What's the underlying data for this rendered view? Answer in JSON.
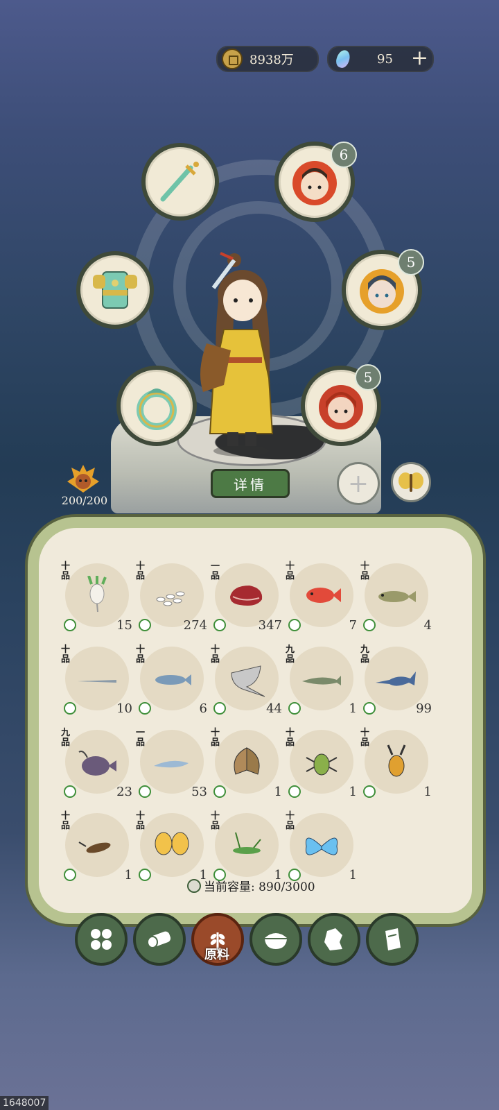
{
  "currency": {
    "coins": "8938万",
    "gems": "95",
    "add_label": "+"
  },
  "equipment_badges": {
    "top_right": "6",
    "mid_right": "5",
    "low_right": "5"
  },
  "stamina": "200/200",
  "detail_label": "详情",
  "add_slot_label": "+",
  "inventory": [
    {
      "grade": "十品",
      "count": "15",
      "icon": "radish-icon"
    },
    {
      "grade": "十品",
      "count": "274",
      "icon": "rice-icon"
    },
    {
      "grade": "一品",
      "count": "347",
      "icon": "meat-icon"
    },
    {
      "grade": "十品",
      "count": "7",
      "icon": "red-fish-icon"
    },
    {
      "grade": "十品",
      "count": "4",
      "icon": "cod-fish-icon"
    },
    {
      "grade": "十品",
      "count": "10",
      "icon": "needlefish-icon"
    },
    {
      "grade": "十品",
      "count": "6",
      "icon": "salmon-icon"
    },
    {
      "grade": "十品",
      "count": "44",
      "icon": "stingray-icon"
    },
    {
      "grade": "九品",
      "count": "1",
      "icon": "sturgeon-icon"
    },
    {
      "grade": "九品",
      "count": "99",
      "icon": "swordfish-icon"
    },
    {
      "grade": "九品",
      "count": "23",
      "icon": "anglerfish-icon"
    },
    {
      "grade": "一品",
      "count": "53",
      "icon": "ghost-fish-icon"
    },
    {
      "grade": "十品",
      "count": "1",
      "icon": "brown-moth-icon"
    },
    {
      "grade": "十品",
      "count": "1",
      "icon": "green-beetle-icon"
    },
    {
      "grade": "十品",
      "count": "1",
      "icon": "stag-beetle-icon"
    },
    {
      "grade": "十品",
      "count": "1",
      "icon": "cockroach-icon"
    },
    {
      "grade": "十品",
      "count": "1",
      "icon": "yellow-butterfly-icon"
    },
    {
      "grade": "十品",
      "count": "1",
      "icon": "grasshopper-icon"
    },
    {
      "grade": "十品",
      "count": "1",
      "icon": "blue-butterfly-icon"
    }
  ],
  "capacity_label": "当前容量: 890/3000",
  "nav_active_label": "原料",
  "corner_id": "1648007"
}
